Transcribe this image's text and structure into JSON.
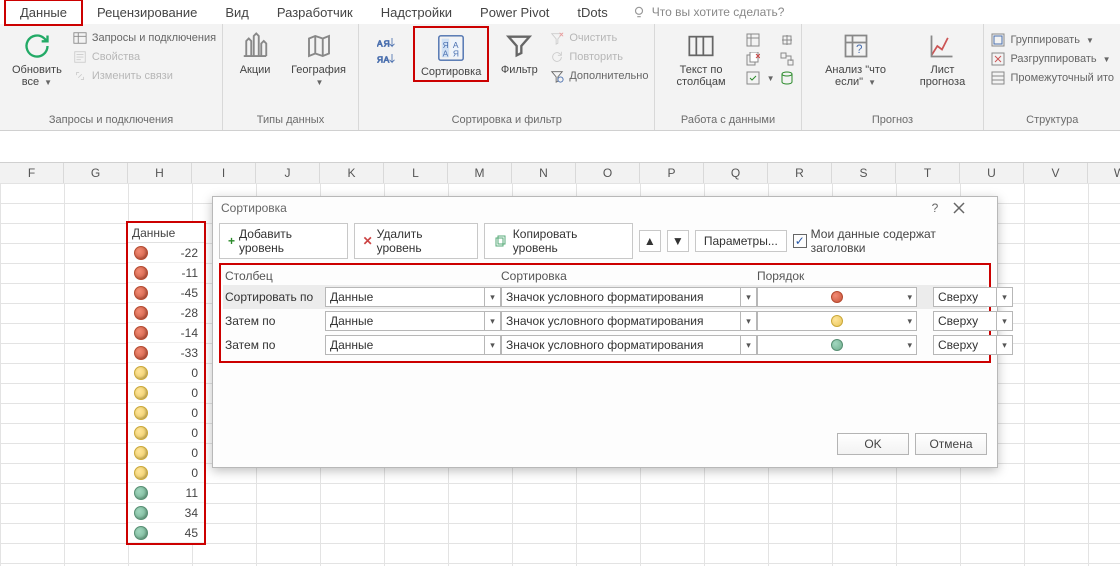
{
  "tabs": {
    "items": [
      "Данные",
      "Рецензирование",
      "Вид",
      "Разработчик",
      "Надстройки",
      "Power Pivot",
      "tDots"
    ],
    "tellme_placeholder": "Что вы хотите сделать?"
  },
  "ribbon": {
    "group_queries": {
      "label": "Запросы и подключения",
      "refresh_all": "Обновить все",
      "queries_conn": "Запросы и подключения",
      "properties": "Свойства",
      "edit_links": "Изменить связи"
    },
    "group_datatypes": {
      "label": "Типы данных",
      "stocks": "Акции",
      "geography": "География"
    },
    "group_sortfilter": {
      "label": "Сортировка и фильтр",
      "sort": "Сортировка",
      "filter": "Фильтр",
      "clear": "Очистить",
      "reapply": "Повторить",
      "advanced": "Дополнительно"
    },
    "group_datatools": {
      "label": "Работа с данными",
      "text_to_cols": "Текст по столбцам"
    },
    "group_forecast": {
      "label": "Прогноз",
      "whatif": "Анализ \"что если\"",
      "forecast_sheet": "Лист прогноза"
    },
    "group_outline": {
      "label": "Структура",
      "group": "Группировать",
      "ungroup": "Разгруппировать",
      "subtotal": "Промежуточный ито"
    }
  },
  "columns": [
    "F",
    "G",
    "H",
    "I",
    "J",
    "K",
    "L",
    "M",
    "N",
    "O",
    "P",
    "Q",
    "R",
    "S",
    "T",
    "U",
    "V",
    "W"
  ],
  "data_block": {
    "header": "Данные",
    "rows": [
      {
        "color": "red",
        "value": -22
      },
      {
        "color": "red",
        "value": -11
      },
      {
        "color": "red",
        "value": -45
      },
      {
        "color": "red",
        "value": -28
      },
      {
        "color": "red",
        "value": -14
      },
      {
        "color": "red",
        "value": -33
      },
      {
        "color": "amber",
        "value": 0
      },
      {
        "color": "amber",
        "value": 0
      },
      {
        "color": "amber",
        "value": 0
      },
      {
        "color": "amber",
        "value": 0
      },
      {
        "color": "amber",
        "value": 0
      },
      {
        "color": "amber",
        "value": 0
      },
      {
        "color": "green",
        "value": 11
      },
      {
        "color": "green",
        "value": 34
      },
      {
        "color": "green",
        "value": 45
      }
    ]
  },
  "dialog": {
    "title": "Сортировка",
    "add_level": "Добавить уровень",
    "delete_level": "Удалить уровень",
    "copy_level": "Копировать уровень",
    "options": "Параметры...",
    "my_data_headers": "Мои данные содержат заголовки",
    "col_header": "Столбец",
    "sort_header": "Сортировка",
    "order_header": "Порядок",
    "sort_by": "Сортировать по",
    "then_by": "Затем по",
    "ok": "OK",
    "cancel": "Отмена",
    "levels": [
      {
        "field": "Данные",
        "sort_on": "Значок условного форматирования",
        "icon": "red",
        "order": "Сверху"
      },
      {
        "field": "Данные",
        "sort_on": "Значок условного форматирования",
        "icon": "amber",
        "order": "Сверху"
      },
      {
        "field": "Данные",
        "sort_on": "Значок условного форматирования",
        "icon": "green",
        "order": "Сверху"
      }
    ]
  }
}
